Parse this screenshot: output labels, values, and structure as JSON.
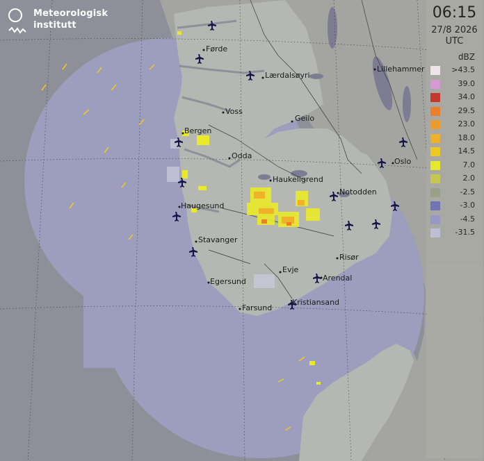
{
  "logo": {
    "line1": "Meteorologisk",
    "line2": "institutt"
  },
  "timestamp": {
    "time": "06:15",
    "date": "27/8 2026",
    "zone": "UTC"
  },
  "legend": {
    "unit": "dBZ",
    "items": [
      {
        "label": ">43.5",
        "color": "#f2e8ee"
      },
      {
        "label": "39.0",
        "color": "#d89ad6"
      },
      {
        "label": "34.0",
        "color": "#c8342a"
      },
      {
        "label": "29.5",
        "color": "#ee7e28"
      },
      {
        "label": "23.0",
        "color": "#f09a28"
      },
      {
        "label": "18.0",
        "color": "#f0b228"
      },
      {
        "label": "14.5",
        "color": "#f0cc1c"
      },
      {
        "label": "7.0",
        "color": "#eaea28"
      },
      {
        "label": "2.0",
        "color": "#c8c850"
      },
      {
        "label": "-2.5",
        "color": "#98a088"
      },
      {
        "label": "-3.0",
        "color": "#7070b8"
      },
      {
        "label": "-4.5",
        "color": "#9898c8"
      },
      {
        "label": "-31.5",
        "color": "#c0c0d8"
      }
    ]
  },
  "cities": [
    {
      "name": "Førde"
    },
    {
      "name": "Lærdalsøyri"
    },
    {
      "name": "Lillehammer"
    },
    {
      "name": "Voss"
    },
    {
      "name": "Geilo"
    },
    {
      "name": "Bergen"
    },
    {
      "name": "Odda"
    },
    {
      "name": "Oslo"
    },
    {
      "name": "Haukeligrend"
    },
    {
      "name": "Notodden"
    },
    {
      "name": "Haugesund"
    },
    {
      "name": "Stavanger"
    },
    {
      "name": "Evje"
    },
    {
      "name": "Risør"
    },
    {
      "name": "Arendal"
    },
    {
      "name": "Egersund"
    },
    {
      "name": "Farsund"
    },
    {
      "name": "Kristiansand"
    }
  ],
  "colors": {
    "sea": "#8f8f99",
    "land": "#a4a5a0",
    "radar_coverage": "#9d9dbd",
    "land_in_coverage": "#b4b7b2",
    "lakes": "#7c7d93",
    "airport": "#15154a"
  },
  "icons": {
    "airport": "airplane-icon",
    "logo": "met-logo-icon"
  }
}
